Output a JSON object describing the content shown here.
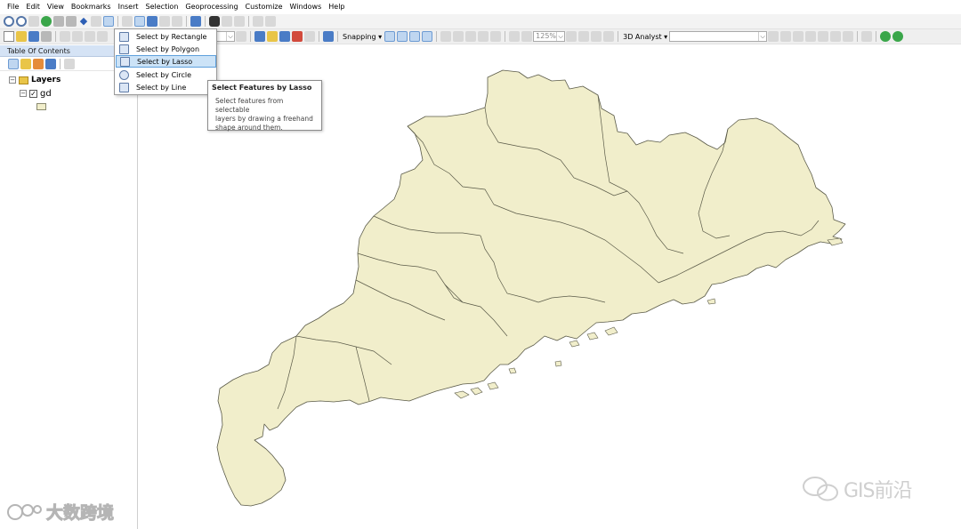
{
  "menubar": [
    "File",
    "Edit",
    "View",
    "Bookmarks",
    "Insert",
    "Selection",
    "Geoprocessing",
    "Customize",
    "Windows",
    "Help"
  ],
  "toolbar": {
    "snapping_label": "Snapping ▾",
    "zoom_combo": "125%",
    "analyst_label": "3D Analyst ▾",
    "analyst_combo": ""
  },
  "toc": {
    "title": "Table Of Contents",
    "root_label": "Layers",
    "layer_name": "gd"
  },
  "select_menu": {
    "items": [
      "Select by Rectangle",
      "Select by Polygon",
      "Select by Lasso",
      "Select by Circle",
      "Select by Line"
    ],
    "active_index": 2
  },
  "tooltip": {
    "title": "Select Features by Lasso",
    "body_lines": [
      "Select features from selectable",
      "layers by drawing a freehand",
      "shape around them."
    ]
  },
  "watermarks": {
    "right": "GIS前沿",
    "left": "大数跨境"
  },
  "colors": {
    "polygon_fill": "#f1eecb",
    "polygon_stroke": "#5a5a48",
    "menu_highlight": "#cce3f7",
    "toc_header": "#d5e3f5"
  }
}
